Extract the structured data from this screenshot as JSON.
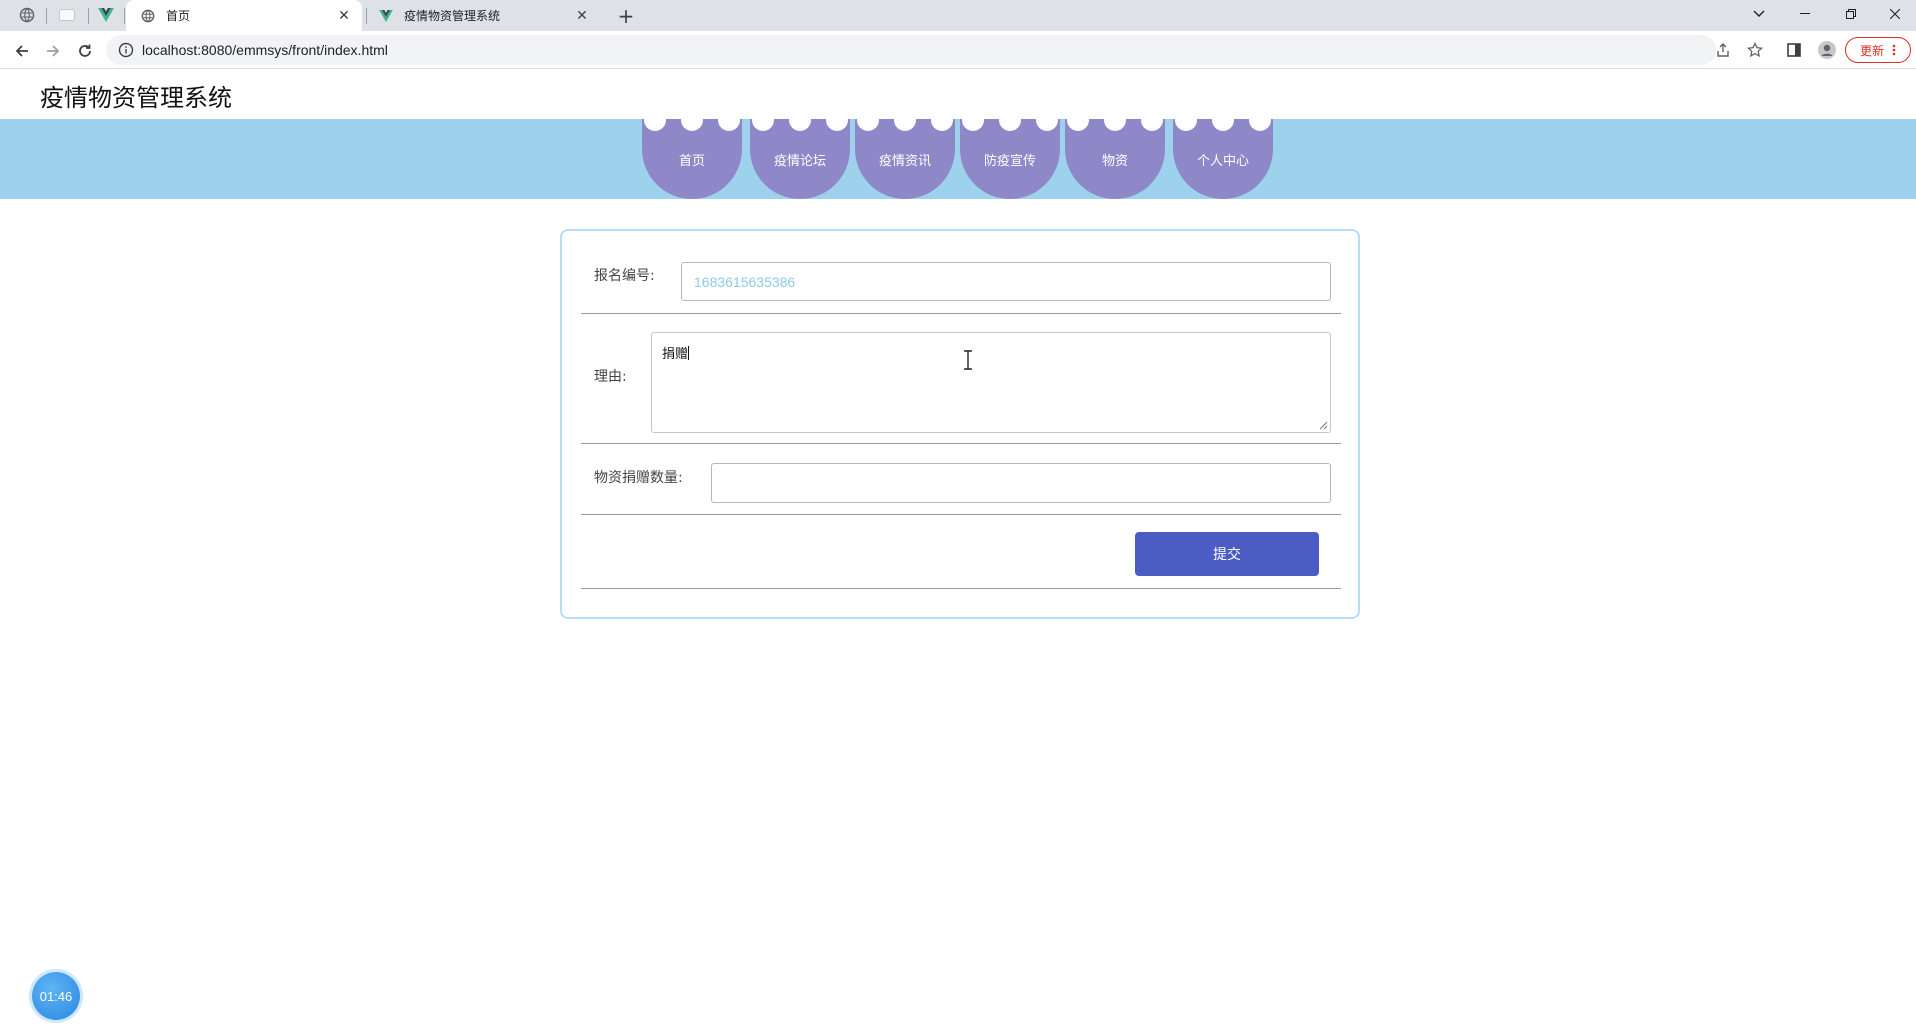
{
  "browser": {
    "tabs": [
      {
        "title": "首页",
        "active": true
      },
      {
        "title": "疫情物资管理系统",
        "active": false
      }
    ],
    "new_tab_label": "+",
    "address": "localhost:8080/emmsys/front/index.html",
    "update_label": "更新",
    "close_glyph": "✕",
    "icons": [
      "back-icon",
      "forward-icon",
      "reload-icon",
      "info-icon",
      "share-icon",
      "star-icon",
      "sidepanel-icon",
      "profile-icon",
      "menu-icon"
    ]
  },
  "site": {
    "title": "疫情物资管理系统",
    "nav": [
      "首页",
      "疫情论坛",
      "疫情资讯",
      "防疫宣传",
      "物资",
      "个人中心"
    ]
  },
  "form": {
    "signup_no_label": "报名编号:",
    "signup_no_value": "1683615635386",
    "reason_label": "理由:",
    "reason_value": "捐赠",
    "quantity_label": "物资捐赠数量:",
    "quantity_value": "",
    "submit_label": "提交"
  },
  "timer": "01:46",
  "colors": {
    "nav_band": "#9dd1ec",
    "nav_item": "#8e88c8",
    "submit": "#4b5cc4",
    "card_border": "#b6dff3"
  }
}
